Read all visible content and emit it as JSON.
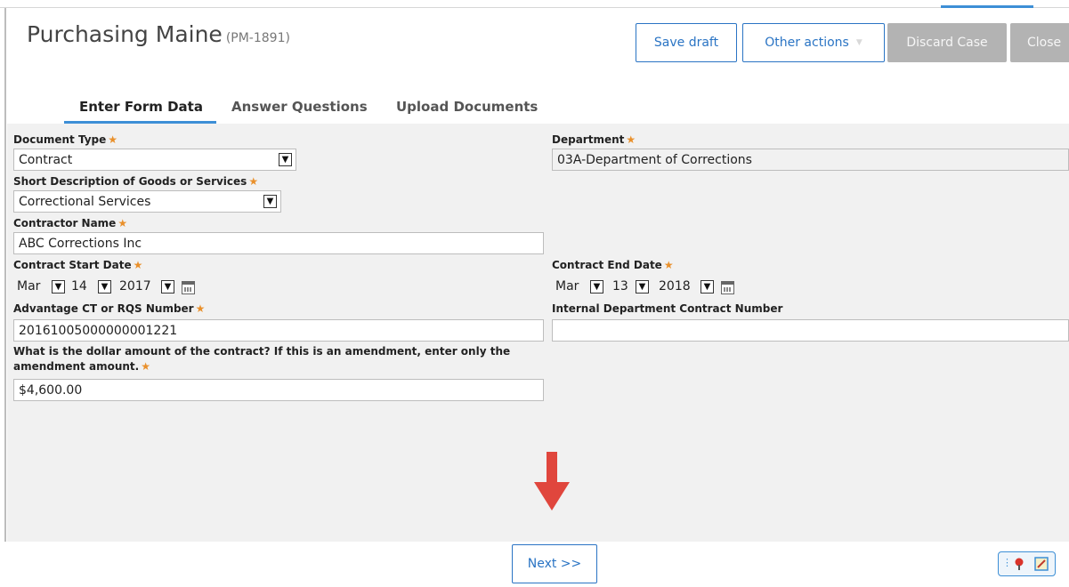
{
  "header": {
    "title": "Purchasing Maine",
    "case_id": "(PM-1891)",
    "buttons": {
      "save_draft": "Save draft",
      "other_actions": "Other actions",
      "discard_case": "Discard Case",
      "close": "Close"
    }
  },
  "tabs": [
    {
      "label": "Enter Form Data",
      "active": true
    },
    {
      "label": "Answer Questions",
      "active": false
    },
    {
      "label": "Upload Documents",
      "active": false
    }
  ],
  "required_marker": "★",
  "form": {
    "document_type": {
      "label": "Document Type",
      "value": "Contract"
    },
    "department": {
      "label": "Department",
      "value": "03A-Department of Corrections"
    },
    "short_description": {
      "label": "Short Description of Goods or Services",
      "value": "Correctional Services"
    },
    "contractor_name": {
      "label": "Contractor Name",
      "value": "ABC Corrections Inc"
    },
    "contract_start_date": {
      "label": "Contract Start Date",
      "month": "Mar",
      "day": "14",
      "year": "2017"
    },
    "contract_end_date": {
      "label": "Contract End Date",
      "month": "Mar",
      "day": "13",
      "year": "2018"
    },
    "advantage_number": {
      "label": "Advantage CT or RQS Number",
      "value": "20161005000000001221"
    },
    "internal_contract_number": {
      "label": "Internal Department Contract Number",
      "value": ""
    },
    "dollar_amount": {
      "label_line1": "What is the dollar amount of the contract? If this is an amendment, enter only the",
      "label_line2": "amendment amount.",
      "value": "$4,600.00"
    }
  },
  "footer": {
    "next_label": "Next >>"
  },
  "colors": {
    "accent": "#2a74c4",
    "required": "#e9902b",
    "arrow": "#e0463d"
  }
}
